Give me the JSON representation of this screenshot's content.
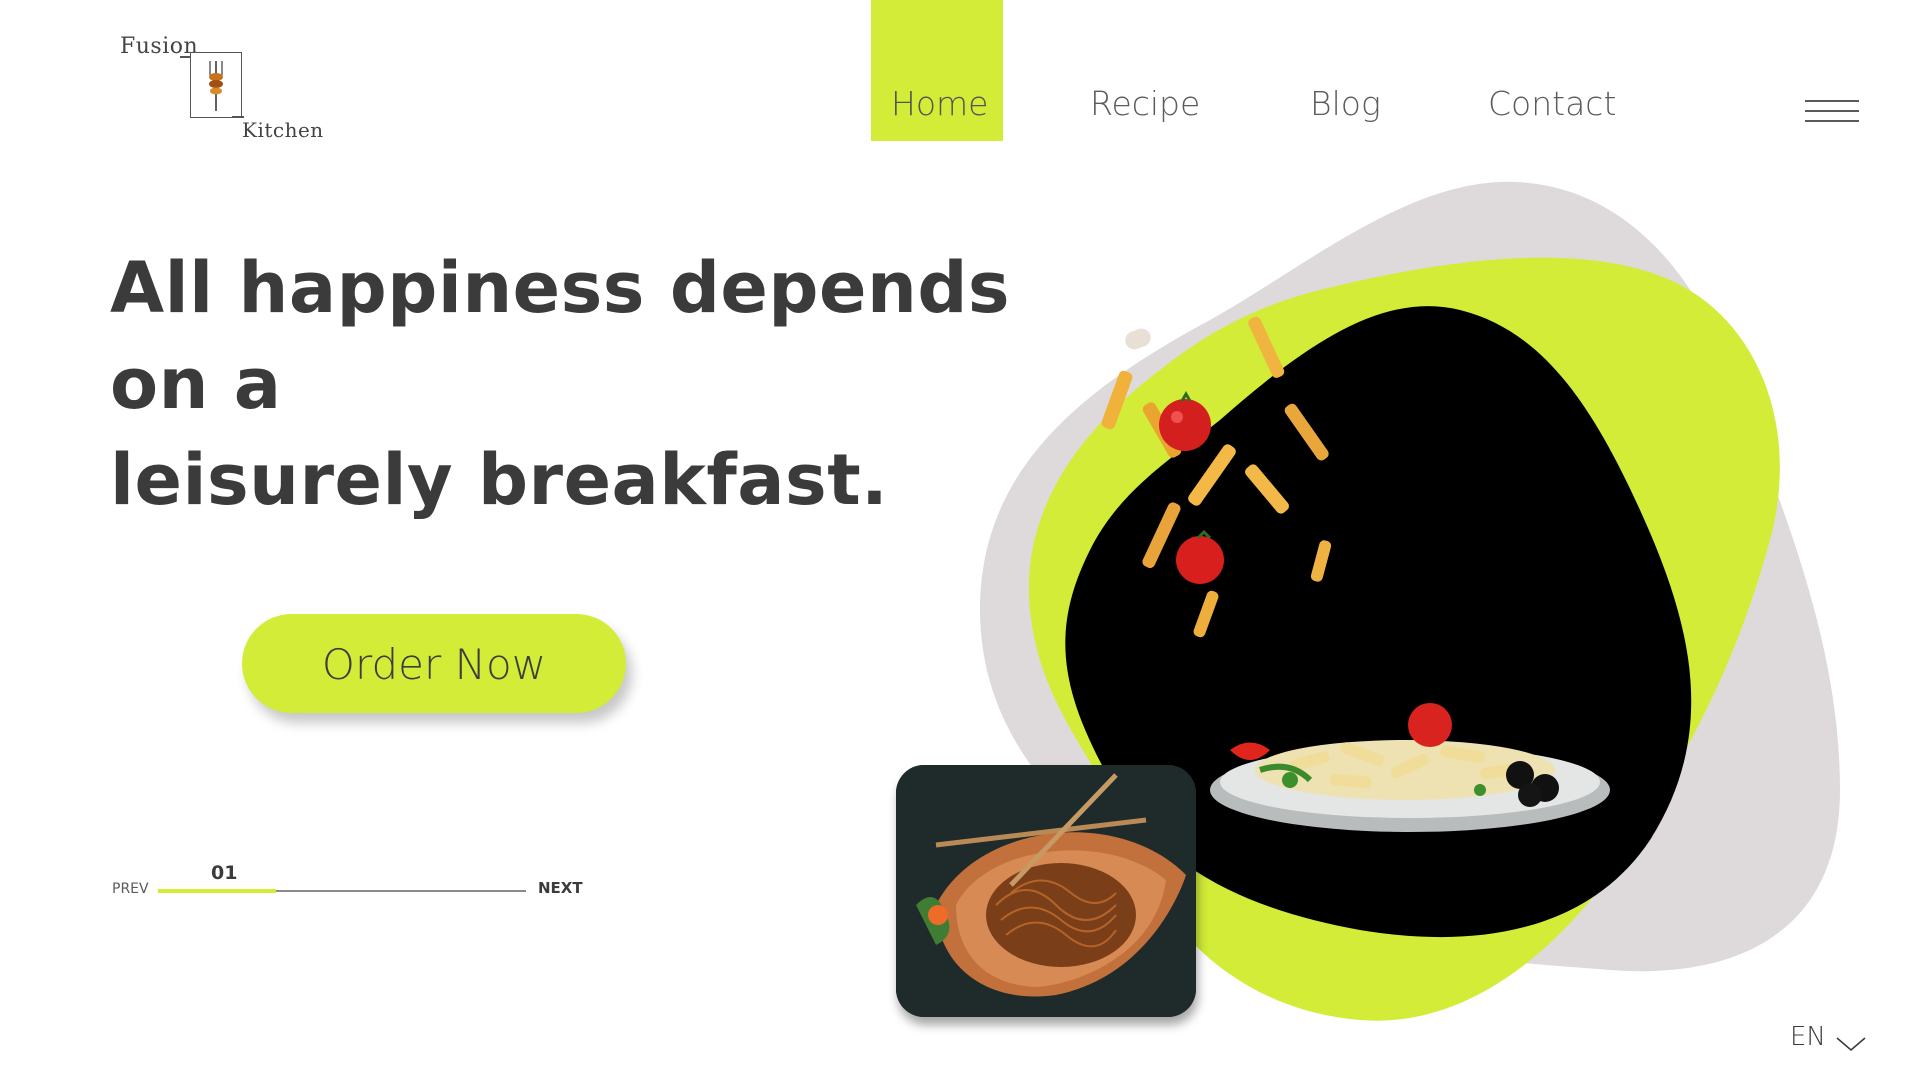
{
  "brand": {
    "word1": "Fusion",
    "word2": "Kitchen",
    "accent": "#d2ec38"
  },
  "nav": {
    "items": [
      {
        "label": "Home",
        "active": true
      },
      {
        "label": "Recipe",
        "active": false
      },
      {
        "label": "Blog",
        "active": false
      },
      {
        "label": "Contact",
        "active": false
      }
    ],
    "menu_icon": "hamburger-icon"
  },
  "hero": {
    "headline_line1": "All happiness depends on a",
    "headline_line2": "leisurely breakfast.",
    "cta_label": "Order Now"
  },
  "slider": {
    "prev_label": "PREV",
    "next_label": "NEXT",
    "current": "01",
    "progress": 0.32
  },
  "language": {
    "label": "EN",
    "icon": "chevron-down-icon"
  },
  "colors": {
    "accent": "#d2ec38",
    "blob_gray": "#dedadb",
    "dark": "#000000",
    "text": "#3b3b3b"
  }
}
